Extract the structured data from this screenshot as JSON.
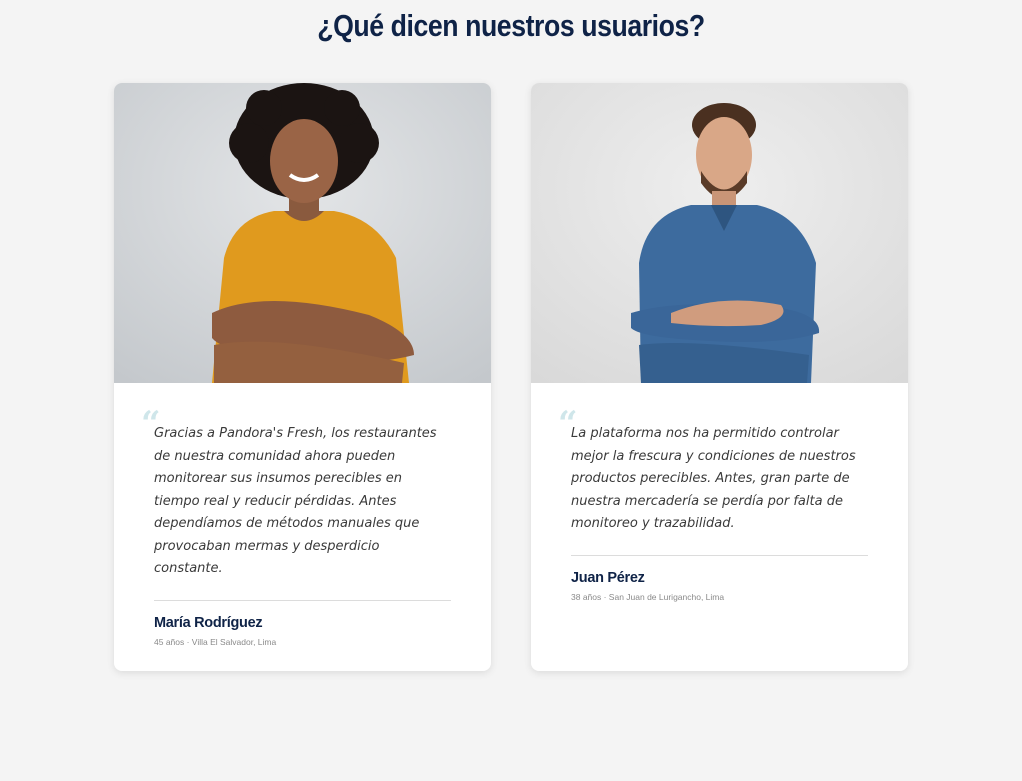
{
  "section": {
    "title": "¿Qué dicen nuestros usuarios?"
  },
  "testimonials": [
    {
      "quote": "Gracias a Pandora's Fresh, los restaurantes de nuestra comunidad ahora pueden monitorear sus insumos perecibles en tiempo real y reducir pérdidas. Antes dependíamos de métodos manuales que provocaban mermas y desperdicio constante.",
      "name": "María Rodríguez",
      "meta": "45 años · Villa El Salvador, Lima",
      "photo": "woman-yellow-shirt-arms-crossed"
    },
    {
      "quote": "La plataforma nos ha permitido controlar mejor la frescura y condiciones de nuestros productos perecibles. Antes, gran parte de nuestra mercadería se perdía por falta de monitoreo y trazabilidad.",
      "name": "Juan Pérez",
      "meta": "38 años · San Juan de Lurigancho, Lima",
      "photo": "man-denim-shirt-arms-crossed"
    }
  ],
  "icons": {
    "quote": "quote-icon"
  },
  "colors": {
    "title": "#0f2347",
    "quote_mark": "#cfe6ea",
    "background": "#f4f4f4"
  }
}
